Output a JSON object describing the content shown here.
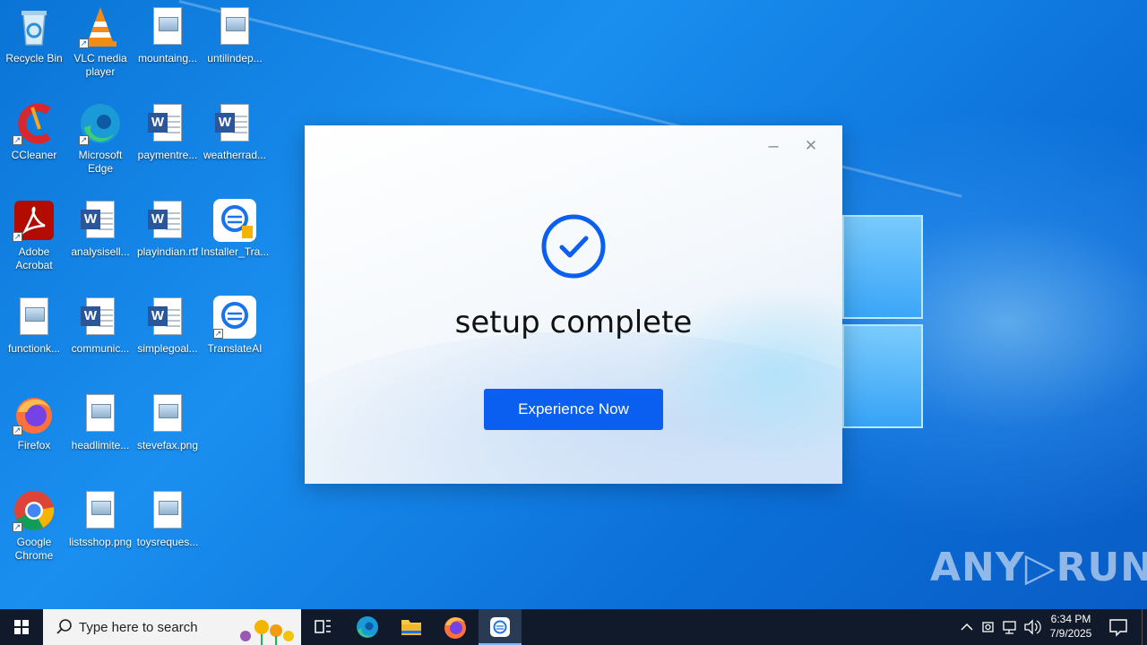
{
  "desktop": {
    "icons": [
      {
        "label": "Recycle Bin",
        "icon": "recycle-bin-icon"
      },
      {
        "label": "VLC media player",
        "icon": "vlc-icon"
      },
      {
        "label": "mountaing...",
        "icon": "image-file-icon"
      },
      {
        "label": "untilindep...",
        "icon": "image-file-icon"
      },
      {
        "label": "CCleaner",
        "icon": "ccleaner-icon"
      },
      {
        "label": "Microsoft Edge",
        "icon": "edge-icon"
      },
      {
        "label": "paymentre...",
        "icon": "word-doc-icon"
      },
      {
        "label": "weatherrad...",
        "icon": "word-doc-icon"
      },
      {
        "label": "Adobe Acrobat",
        "icon": "acrobat-icon"
      },
      {
        "label": "analysisell...",
        "icon": "word-doc-icon"
      },
      {
        "label": "playindian.rtf",
        "icon": "word-doc-icon"
      },
      {
        "label": "Installer_Tra...",
        "icon": "translate-installer-icon"
      },
      {
        "label": "functionk...",
        "icon": "image-file-icon"
      },
      {
        "label": "communic...",
        "icon": "word-doc-icon"
      },
      {
        "label": "simplegoal...",
        "icon": "word-doc-icon"
      },
      {
        "label": "TranslateAI",
        "icon": "translate-icon"
      },
      {
        "label": "Firefox",
        "icon": "firefox-icon"
      },
      {
        "label": "headlimite...",
        "icon": "image-file-icon"
      },
      {
        "label": "stevefax.png",
        "icon": "image-file-icon"
      },
      {
        "label": "Google Chrome",
        "icon": "chrome-icon"
      },
      {
        "label": "listsshop.png",
        "icon": "image-file-icon"
      },
      {
        "label": "toysreques...",
        "icon": "image-file-icon"
      }
    ]
  },
  "dialog": {
    "title": "setup complete",
    "button_label": "Experience Now",
    "minimize_glyph": "–",
    "close_glyph": "✕",
    "accent_color": "#0a5ff0"
  },
  "watermark": "ANY▷RUN",
  "taskbar": {
    "search_placeholder": "Type here to search",
    "time": "6:34 PM",
    "date": "7/9/2025"
  }
}
